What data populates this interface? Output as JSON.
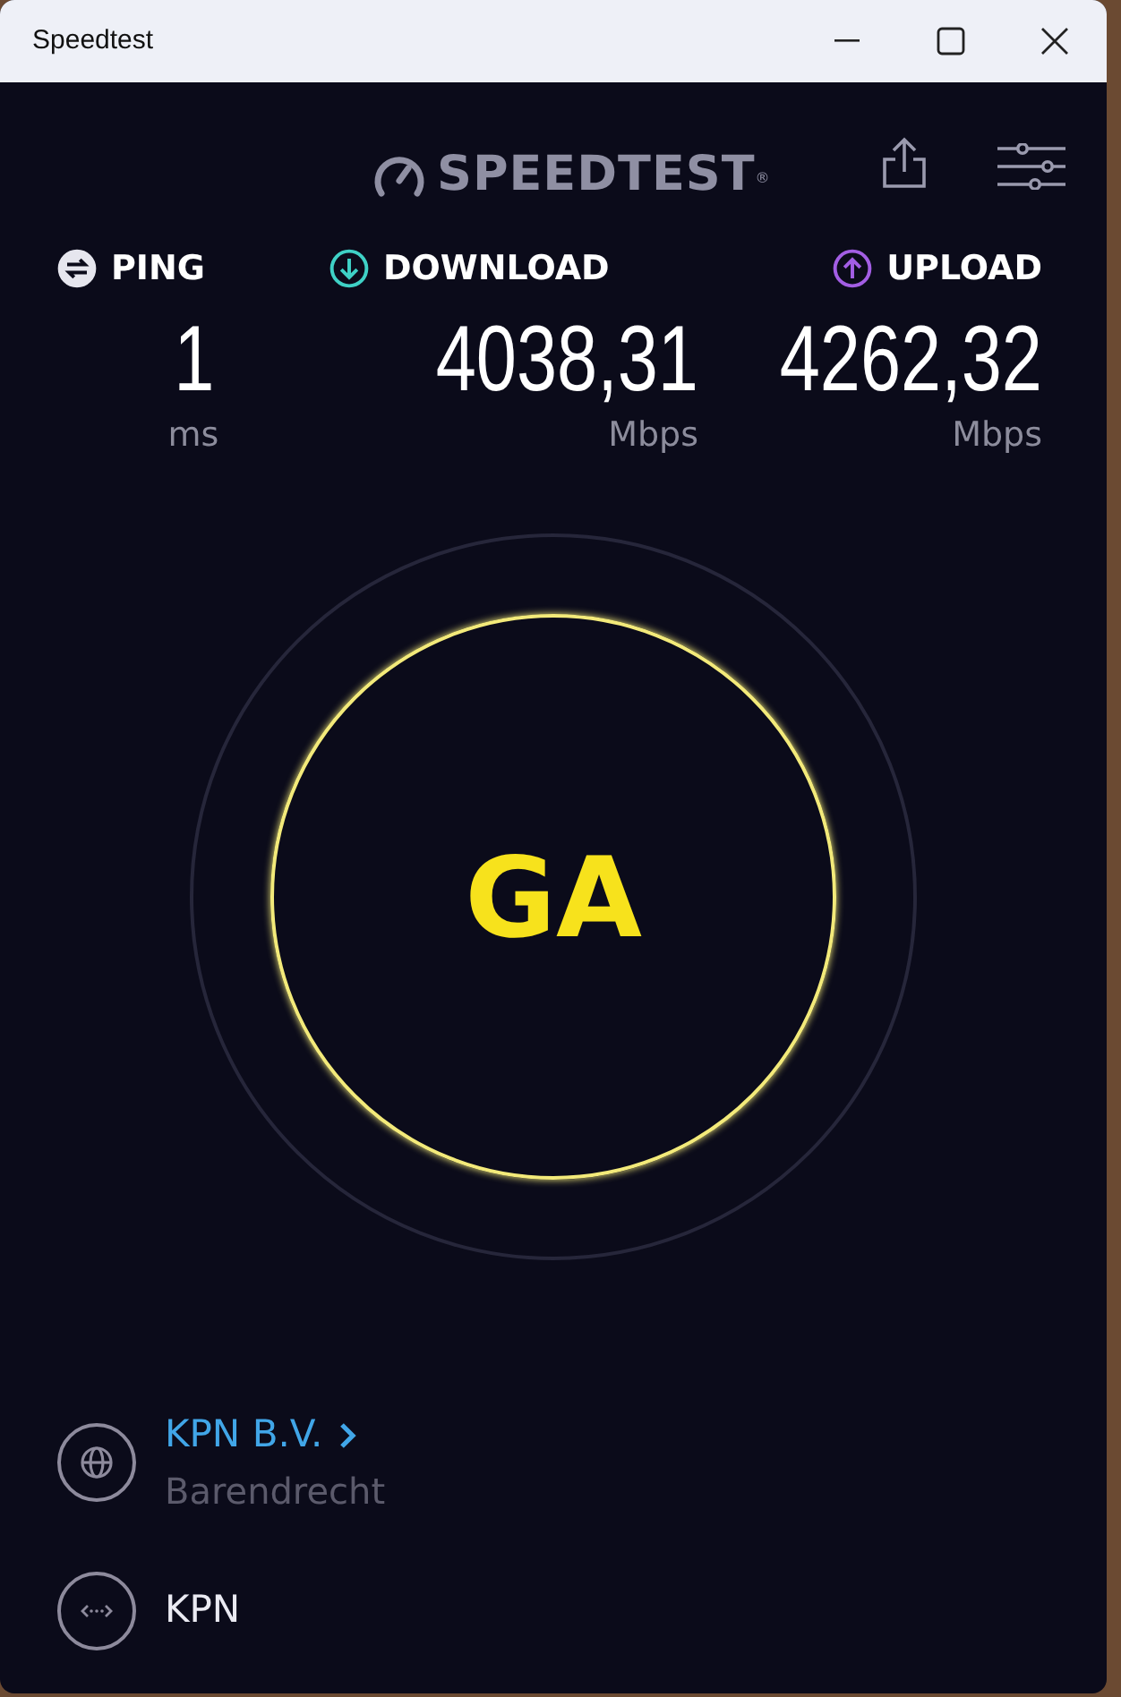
{
  "window": {
    "title": "Speedtest"
  },
  "header": {
    "logo": "SPEEDTEST$^{®}$"
  },
  "stats": [
    {
      "kind": "ping",
      "label": "PING",
      "value": "1",
      "unit": "ms",
      "color": "#e6e6ee"
    },
    {
      "kind": "download",
      "label": "DOWNLOAD",
      "value": "4038,31",
      "unit": "Mbps",
      "color": "#3fd1c6"
    },
    {
      "kind": "upload",
      "label": "UPLOAD",
      "value": "4262,32",
      "unit": "Mbps",
      "color": "#a35ee4"
    }
  ],
  "go_button": {
    "label": "GA"
  },
  "connection": [
    {
      "kind": "isp",
      "name": "KPN B.V.",
      "location": "Barendrecht"
    },
    {
      "kind": "server",
      "name": "KPN"
    }
  ]
}
